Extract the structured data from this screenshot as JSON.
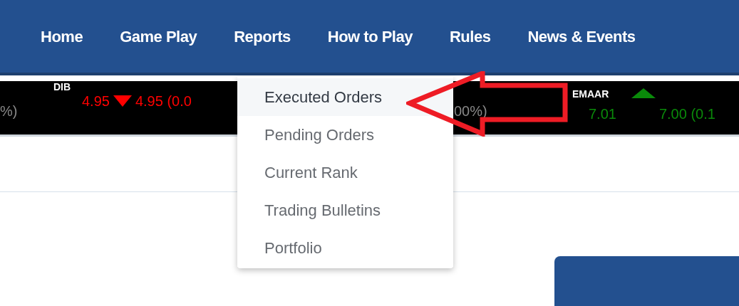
{
  "nav": {
    "items": [
      {
        "label": "Home"
      },
      {
        "label": "Game Play"
      },
      {
        "label": "Reports"
      },
      {
        "label": "How to Play"
      },
      {
        "label": "Rules"
      },
      {
        "label": "News & Events"
      }
    ]
  },
  "ticker": [
    {
      "kind": "tail",
      "text": "%)"
    },
    {
      "kind": "quote",
      "symbol": "DIB",
      "falling": true,
      "price": "4.95",
      "change": "4.95 (0.0"
    },
    {
      "kind": "tail",
      "text": "00%)"
    },
    {
      "kind": "quote",
      "symbol": "EMAAR",
      "falling": false,
      "price": "7.01",
      "change": "7.00 (0.1"
    }
  ],
  "dropdown": {
    "items": [
      {
        "label": "Executed Orders",
        "selected": true
      },
      {
        "label": "Pending Orders",
        "selected": false
      },
      {
        "label": "Current Rank",
        "selected": false
      },
      {
        "label": "Trading Bulletins",
        "selected": false
      },
      {
        "label": "Portfolio",
        "selected": false
      }
    ]
  }
}
